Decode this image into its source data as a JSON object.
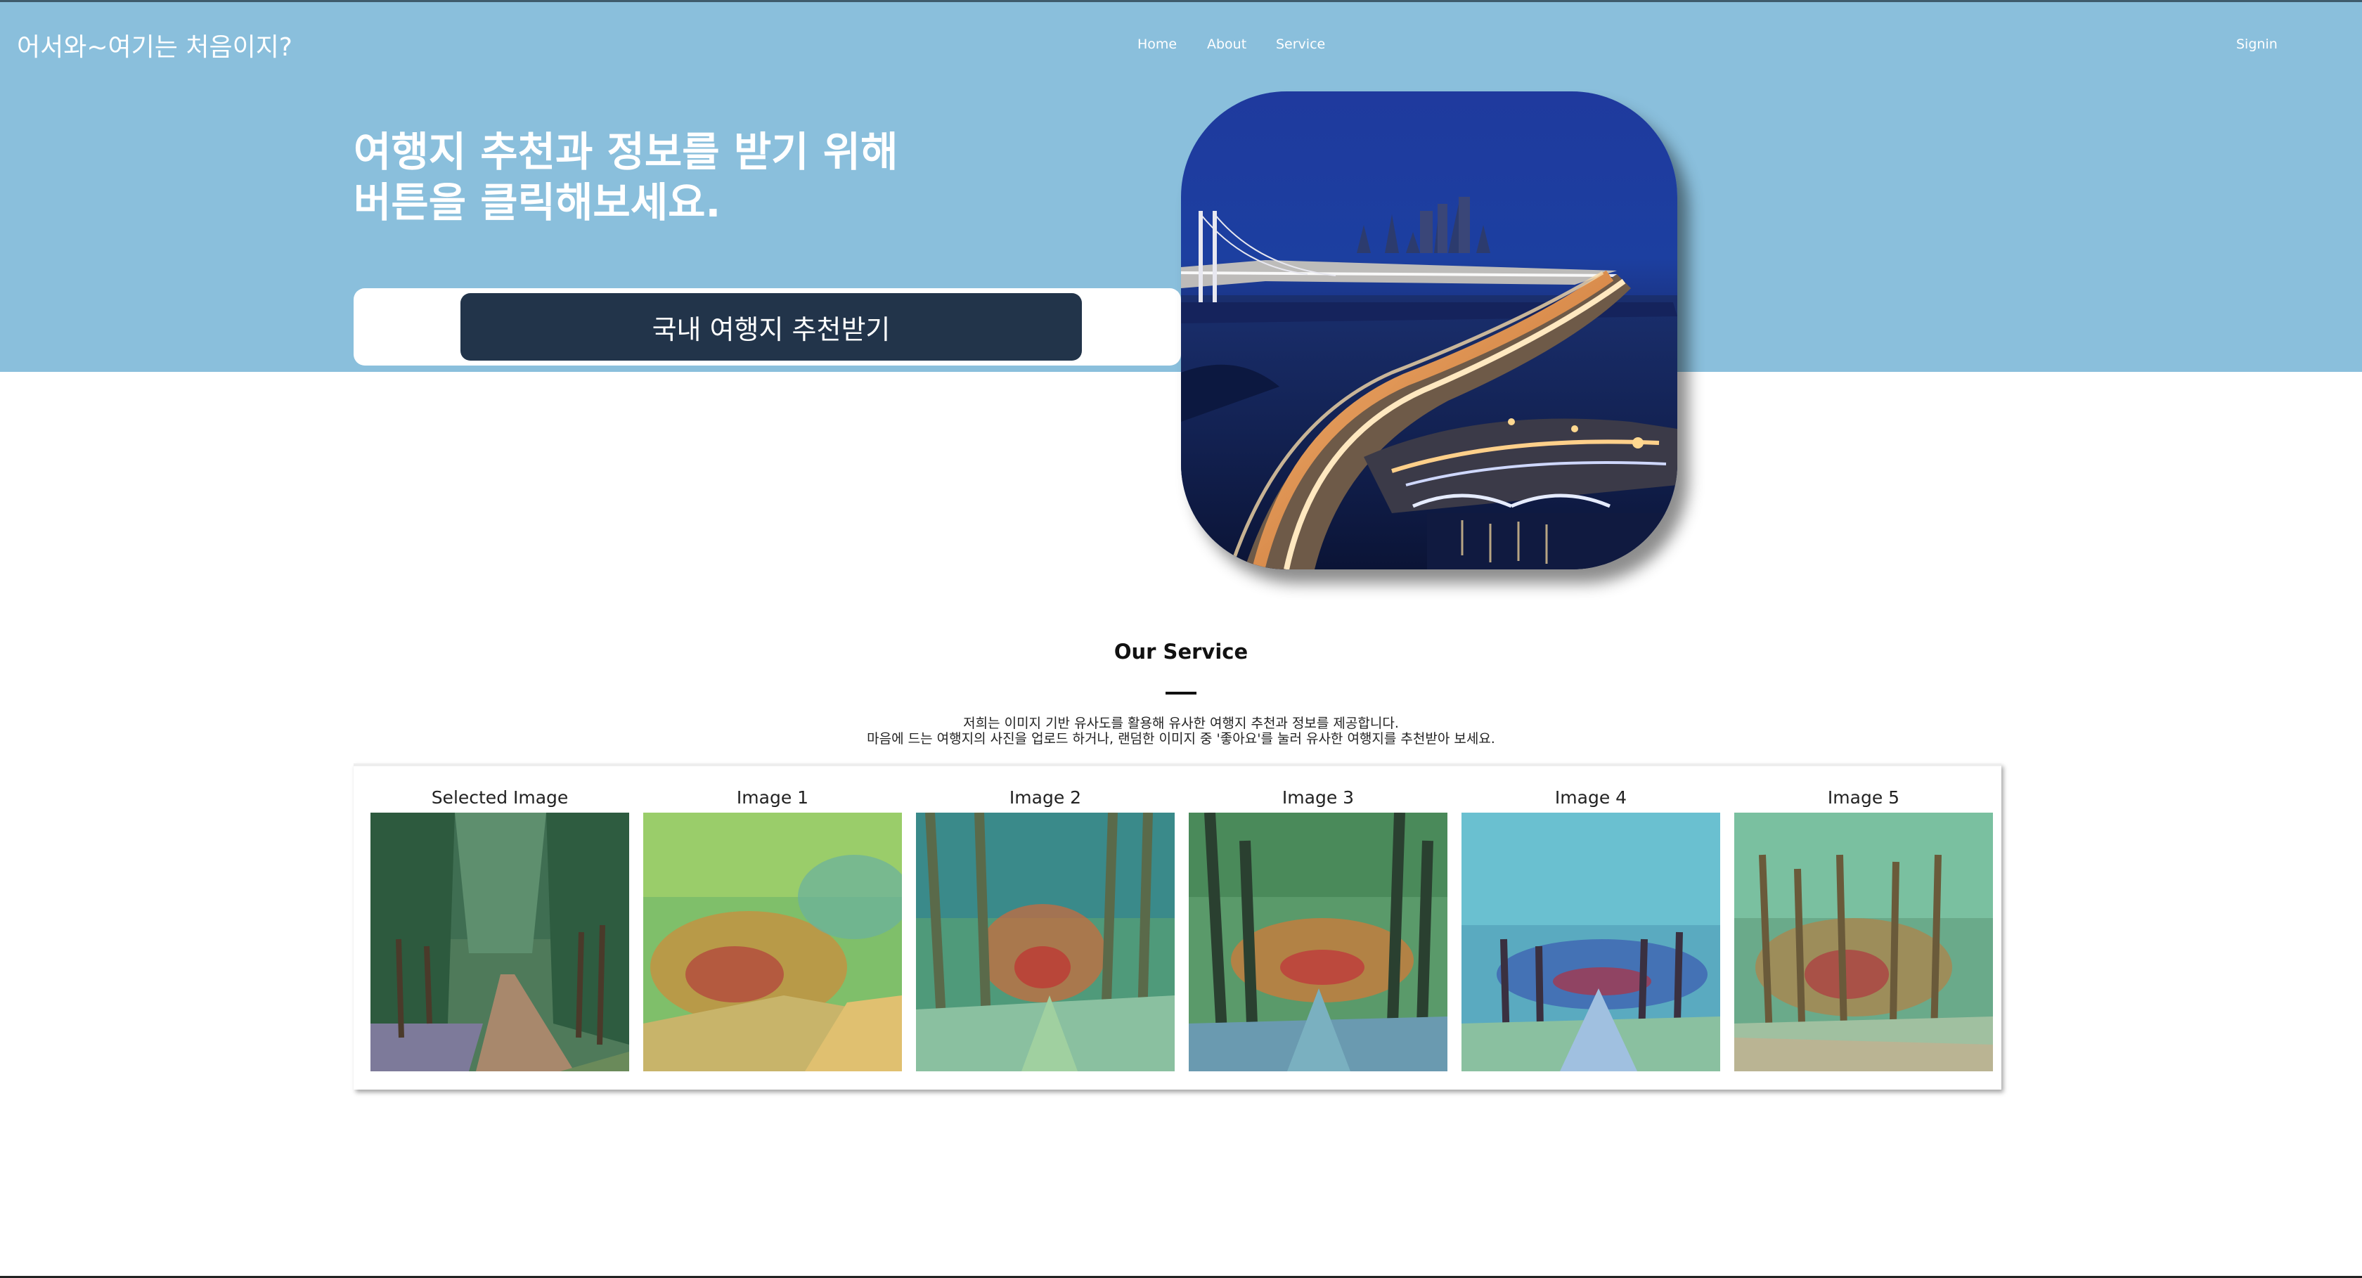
{
  "header": {
    "brand": "어서와~여기는 처음이지?",
    "nav": [
      "Home",
      "About",
      "Service"
    ],
    "signin": "Signin"
  },
  "hero": {
    "headline_line1": "여행지 추천과 정보를 받기 위해",
    "headline_line2": "버튼을 클릭해보세요.",
    "cta_label": "국내 여행지 추천받기"
  },
  "service": {
    "title": "Our Service",
    "desc_line1": "저희는 이미지 기반 유사도를 활용해 유사한 여행지 추천과 정보를 제공합니다.",
    "desc_line2": "마음에 드는 여행지의 사진을 업로드 하거나, 랜덤한 이미지 중 '좋아요'를 눌러 유사한 여행지를 추천받아 보세요."
  },
  "gallery": {
    "labels": [
      "Selected Image",
      "Image 1",
      "Image 2",
      "Image 3",
      "Image 4",
      "Image 5"
    ]
  },
  "colors": {
    "hero_bg": "#8abfdc",
    "cta_bg": "#22344a"
  }
}
